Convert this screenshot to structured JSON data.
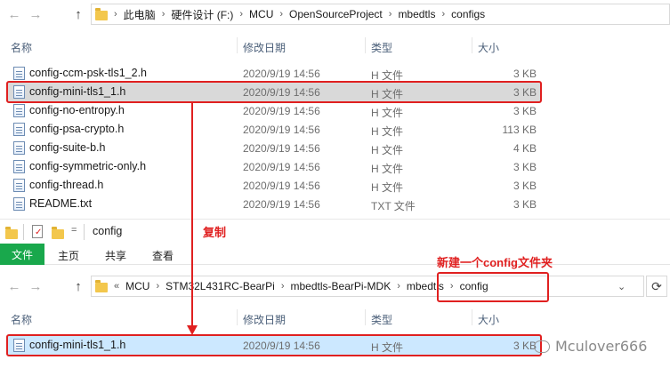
{
  "top_window": {
    "nav": {
      "back": "←",
      "forward": "→",
      "up": "↑"
    },
    "breadcrumb": [
      "此电脑",
      "硬件设计 (F:)",
      "MCU",
      "OpenSourceProject",
      "mbedtls",
      "configs"
    ],
    "columns": {
      "name": "名称",
      "date": "修改日期",
      "type": "类型",
      "size": "大小"
    },
    "files": [
      {
        "name": "config-ccm-psk-tls1_2.h",
        "date": "2020/9/19 14:56",
        "type": "H 文件",
        "size": "3 KB"
      },
      {
        "name": "config-mini-tls1_1.h",
        "date": "2020/9/19 14:56",
        "type": "H 文件",
        "size": "3 KB"
      },
      {
        "name": "config-no-entropy.h",
        "date": "2020/9/19 14:56",
        "type": "H 文件",
        "size": "3 KB"
      },
      {
        "name": "config-psa-crypto.h",
        "date": "2020/9/19 14:56",
        "type": "H 文件",
        "size": "113 KB"
      },
      {
        "name": "config-suite-b.h",
        "date": "2020/9/19 14:56",
        "type": "H 文件",
        "size": "4 KB"
      },
      {
        "name": "config-symmetric-only.h",
        "date": "2020/9/19 14:56",
        "type": "H 文件",
        "size": "3 KB"
      },
      {
        "name": "config-thread.h",
        "date": "2020/9/19 14:56",
        "type": "H 文件",
        "size": "3 KB"
      },
      {
        "name": "README.txt",
        "date": "2020/9/19 14:56",
        "type": "TXT 文件",
        "size": "3 KB"
      }
    ]
  },
  "bottom_window": {
    "title": "config",
    "qat_dropdown": "=",
    "ribbon_tabs": {
      "file": "文件",
      "home": "主页",
      "share": "共享",
      "view": "查看"
    },
    "nav": {
      "back": "←",
      "forward": "→",
      "up": "↑"
    },
    "breadcrumb_prefix": "«",
    "breadcrumb": [
      "MCU",
      "STM32L431RC-BearPi",
      "mbedtls-BearPi-MDK",
      "mbedtls",
      "config"
    ],
    "columns": {
      "name": "名称",
      "date": "修改日期",
      "type": "类型",
      "size": "大小"
    },
    "files": [
      {
        "name": "config-mini-tls1_1.h",
        "date": "2020/9/19 14:56",
        "type": "H 文件",
        "size": "3 KB"
      }
    ]
  },
  "annotations": {
    "copy_label": "复制",
    "new_folder_label": "新建一个config文件夹"
  },
  "watermark": {
    "text": "Mculover666"
  },
  "colors": {
    "annotation_red": "#e02020",
    "file_tab_green": "#19a84c",
    "selection_blue": "#cce8ff",
    "selection_gray": "#d9d9d9"
  }
}
